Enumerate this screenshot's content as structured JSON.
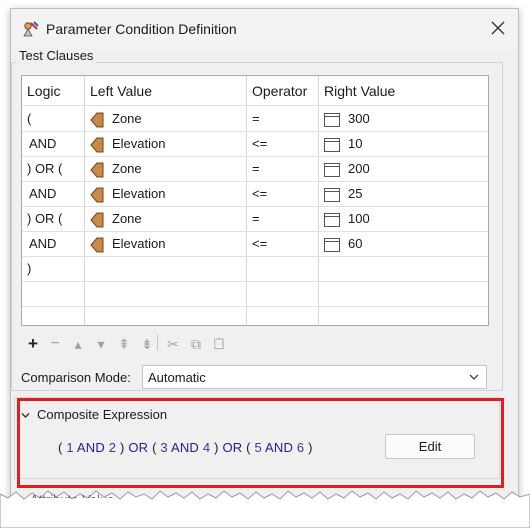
{
  "window": {
    "title": "Parameter Condition Definition"
  },
  "test_clauses": {
    "group_label": "Test Clauses",
    "columns": [
      "Logic",
      "Left Value",
      "Operator",
      "Right Value"
    ],
    "rows": [
      {
        "logic": "(",
        "left": "Zone",
        "operator": "=",
        "right": "300"
      },
      {
        "logic": "AND",
        "left": "Elevation",
        "operator": "<=",
        "right": "10"
      },
      {
        "logic": ") OR (",
        "left": "Zone",
        "operator": "=",
        "right": "200"
      },
      {
        "logic": "AND",
        "left": "Elevation",
        "operator": "<=",
        "right": "25"
      },
      {
        "logic": ") OR (",
        "left": "Zone",
        "operator": "=",
        "right": "100"
      },
      {
        "logic": "AND",
        "left": "Elevation",
        "operator": "<=",
        "right": "60"
      },
      {
        "logic": ")",
        "left": "",
        "operator": "",
        "right": ""
      },
      {
        "logic": "",
        "left": "",
        "operator": "",
        "right": ""
      }
    ]
  },
  "toolbar": {
    "add": "+",
    "remove": "−",
    "move_up": "▴",
    "move_down": "▾",
    "move_top": "⇞",
    "move_bottom": "⇟",
    "cut": "✂",
    "copy": "⧉",
    "paste": "📋"
  },
  "comparison_mode": {
    "label": "Comparison Mode:",
    "value": "Automatic"
  },
  "composite": {
    "header": "Composite Expression",
    "expression": {
      "p1": "(",
      "n1": "1",
      "k1": "AND",
      "n2": "2",
      "p2": ")",
      "k2": "OR",
      "p3": "(",
      "n3": "3",
      "k3": "AND",
      "n4": "4",
      "p4": ")",
      "k4": "OR",
      "p5": "(",
      "n5": "5",
      "k5": "AND",
      "n6": "6",
      "p6": ")"
    },
    "edit_label": "Edit"
  },
  "partial_text": "Attribute Value",
  "colors": {
    "highlight": "#e02020",
    "attr_icon": "#b5753a",
    "keyword": "#1f1f8f"
  }
}
